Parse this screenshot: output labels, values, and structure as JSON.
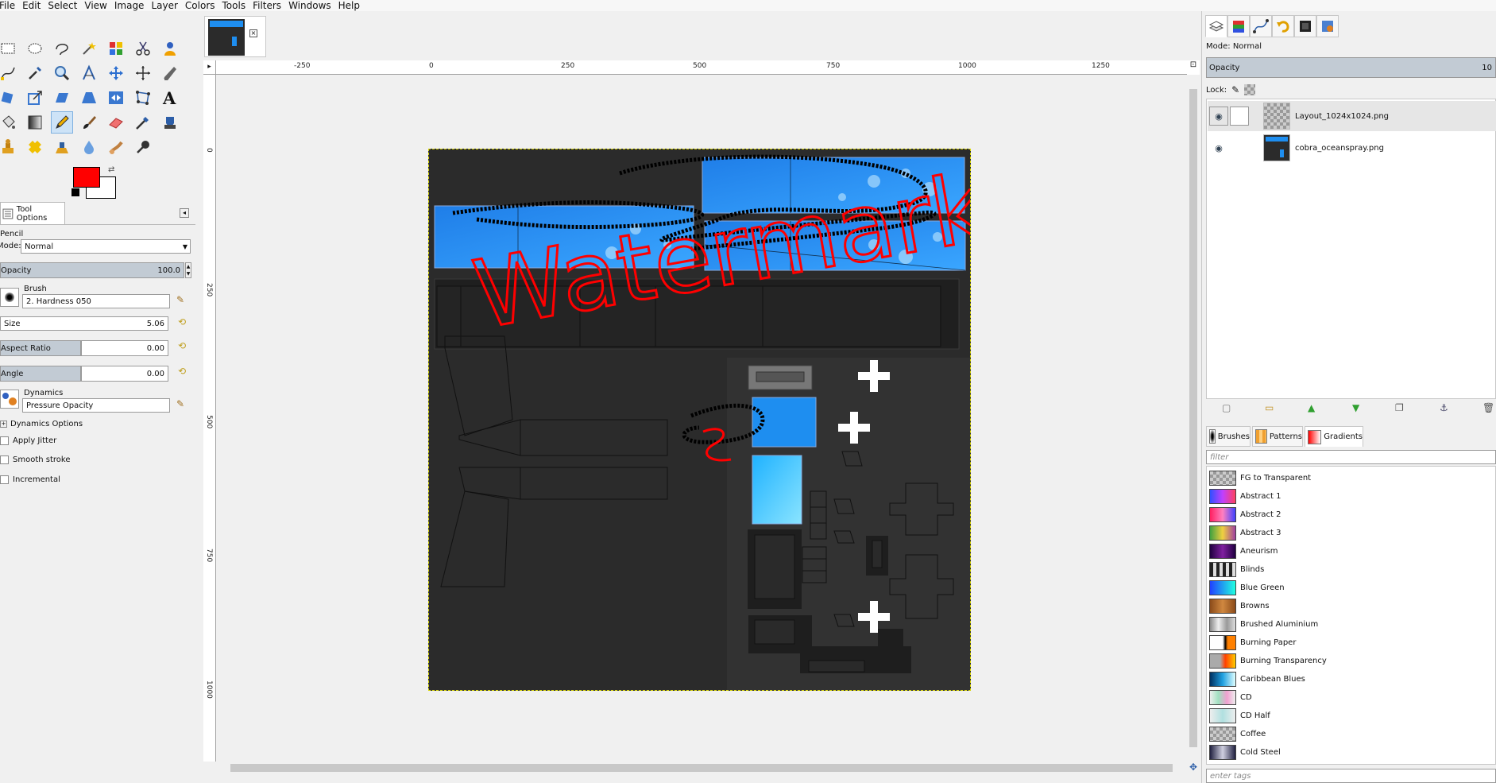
{
  "menu": [
    "File",
    "Edit",
    "Select",
    "View",
    "Image",
    "Layer",
    "Colors",
    "Tools",
    "Filters",
    "Windows",
    "Help"
  ],
  "toolbox": {
    "tools": [
      "rect-select-icon",
      "ellipse-select-icon",
      "lasso-icon",
      "fuzzy-select-icon",
      "color-select-icon",
      "scissors-icon",
      "foreground-select-icon",
      "paths-icon",
      "color-picker-icon",
      "zoom-icon",
      "measure-icon",
      "move-icon",
      "align-icon",
      "crop-icon",
      "rotate-icon",
      "scale-icon",
      "shear-icon",
      "perspective-icon",
      "flip-icon",
      "cage-icon",
      "text-icon",
      "bucket-fill-icon",
      "blend-icon",
      "pencil-icon",
      "paintbrush-icon",
      "eraser-icon",
      "airbrush-icon",
      "ink-icon",
      "clone-icon",
      "heal-icon",
      "perspective-clone-icon",
      "blur-icon",
      "smudge-icon",
      "dodge-burn-icon"
    ],
    "fg_color": "#ff0000",
    "bg_color": "#ffffff"
  },
  "tool_options": {
    "tab_label": "Tool Options",
    "tool_name": "Pencil",
    "mode_label": "Mode:",
    "mode_value": "Normal",
    "opacity_label": "Opacity",
    "opacity_value": "100.0",
    "brush_label": "Brush",
    "brush_value": "2. Hardness 050",
    "size_label": "Size",
    "size_value": "5.06",
    "aspect_label": "Aspect Ratio",
    "aspect_value": "0.00",
    "angle_label": "Angle",
    "angle_value": "0.00",
    "dynamics_label": "Dynamics",
    "dynamics_value": "Pressure Opacity",
    "dynamics_options": "Dynamics Options",
    "apply_jitter": "Apply Jitter",
    "smooth_stroke": "Smooth stroke",
    "incremental": "Incremental"
  },
  "ruler": {
    "top": [
      "-250",
      "0",
      "250",
      "500",
      "750",
      "1000",
      "1250"
    ],
    "left": [
      "0",
      "250",
      "500",
      "750",
      "1000"
    ]
  },
  "canvas": {
    "watermark_text": "Watermark"
  },
  "layers": {
    "mode_label": "Mode:",
    "mode_value": "Normal",
    "opacity_label": "Opacity",
    "opacity_value": "10",
    "lock_label": "Lock:",
    "items": [
      {
        "name": "Layout_1024x1024.png"
      },
      {
        "name": "cobra_oceanspray.png"
      }
    ]
  },
  "resources": {
    "tabs": [
      "Brushes",
      "Patterns",
      "Gradients"
    ],
    "filter_placeholder": "filter",
    "tags_placeholder": "enter tags",
    "gradients": [
      {
        "name": "FG to Transparent",
        "css": "repeating-conic-gradient(#999 0 25%, #ccc 0 50%) 0 0/8px 8px"
      },
      {
        "name": "Abstract 1",
        "css": "linear-gradient(90deg,#3050ff,#c040ff,#ff4060)"
      },
      {
        "name": "Abstract 2",
        "css": "linear-gradient(90deg,#ff2060,#ff80c0,#4040ff)"
      },
      {
        "name": "Abstract 3",
        "css": "linear-gradient(90deg,#40a040,#f0d040,#a040a0)"
      },
      {
        "name": "Aneurism",
        "css": "linear-gradient(90deg,#200040,#8020a0,#200040)"
      },
      {
        "name": "Blinds",
        "css": "repeating-linear-gradient(90deg,#222 0 4px,#ddd 4px 8px)"
      },
      {
        "name": "Blue Green",
        "css": "linear-gradient(90deg,#2040ff,#20ffe0)"
      },
      {
        "name": "Browns",
        "css": "linear-gradient(90deg,#8a4a1a,#d08840,#8a4a1a)"
      },
      {
        "name": "Brushed Aluminium",
        "css": "linear-gradient(90deg,#888,#eee,#999,#ddd)"
      },
      {
        "name": "Burning Paper",
        "css": "linear-gradient(90deg,#fff 50%,#000 60%,#ff8000 70%)"
      },
      {
        "name": "Burning Transparency",
        "css": "linear-gradient(90deg,#aaa 40%,#ff4000 60%,#ffcc00)"
      },
      {
        "name": "Caribbean Blues",
        "css": "linear-gradient(90deg,#003060,#20a0e0,#e0ffff)"
      },
      {
        "name": "CD",
        "css": "linear-gradient(90deg,#eee,#a0e0c0,#f0a0d0,#eee)"
      },
      {
        "name": "CD Half",
        "css": "linear-gradient(90deg,#eee,#b0e0e0,#eee)"
      },
      {
        "name": "Coffee",
        "css": "repeating-conic-gradient(#999 0 25%, #ccc 0 50%) 0 0/8px 8px"
      },
      {
        "name": "Cold Steel",
        "css": "linear-gradient(90deg,#202040,#d0d0e0,#202040)"
      }
    ]
  },
  "colors": {
    "blue_panel": "#1e8ef0",
    "scribble": "#000000",
    "watermark": "#ff0000"
  }
}
